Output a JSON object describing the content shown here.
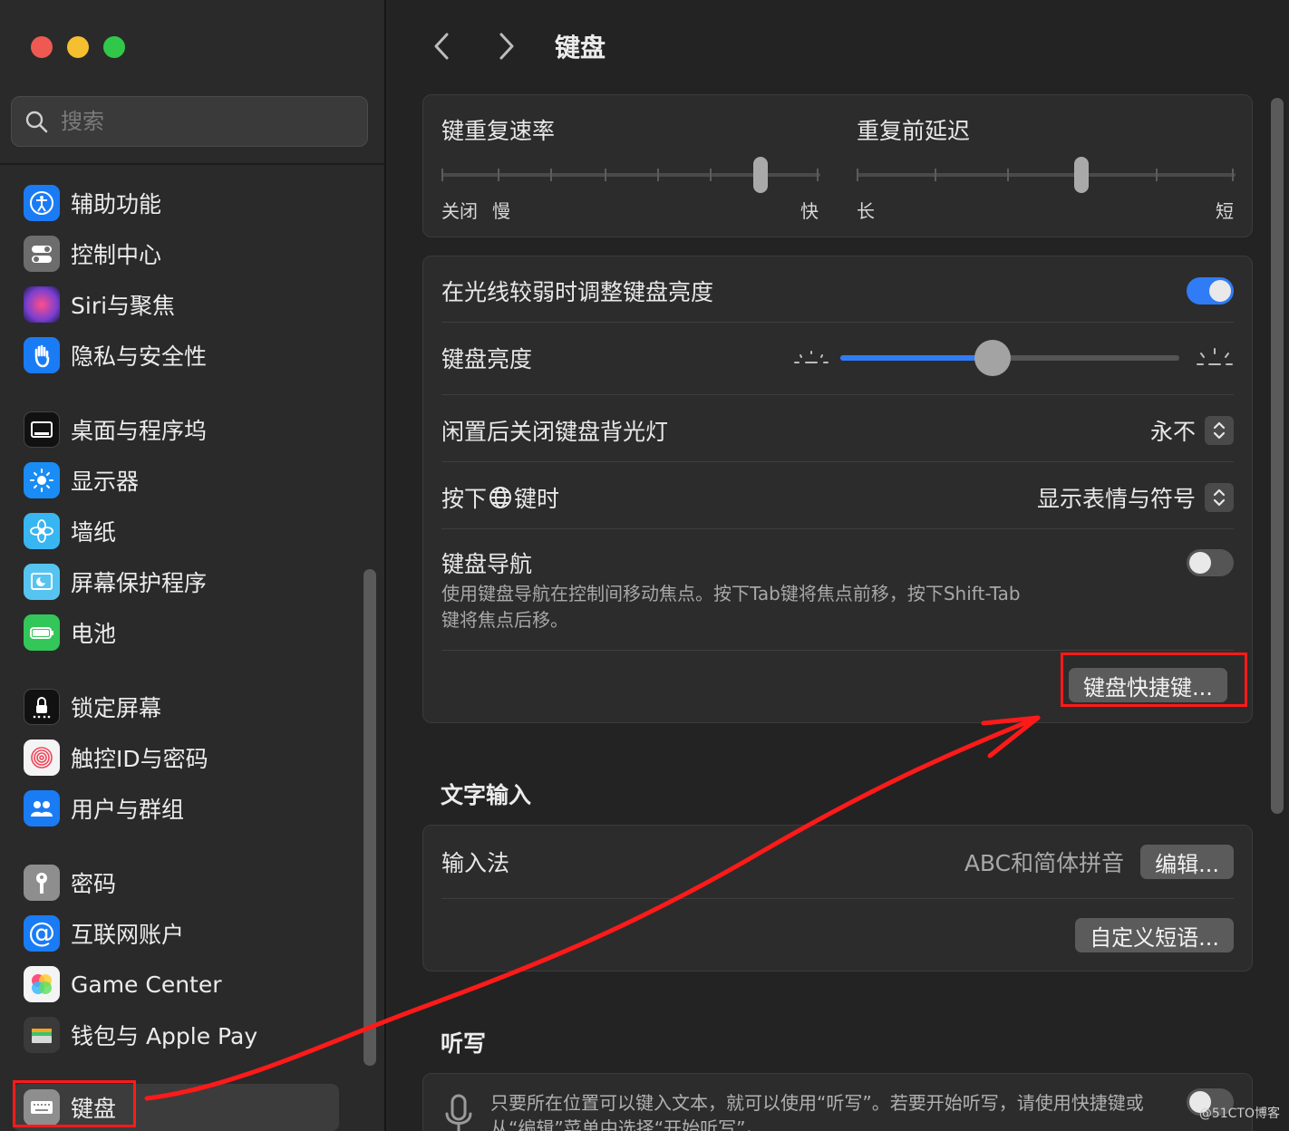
{
  "sidebar": {
    "search_placeholder": "搜索",
    "items": [
      {
        "label": "辅助功能",
        "icon": "accessibility-icon",
        "color": "#1a7cf5"
      },
      {
        "label": "控制中心",
        "icon": "control-center-icon",
        "color": "#6d6d6d"
      },
      {
        "label": "Siri与聚焦",
        "icon": "siri-icon",
        "color": "#7a3fd0"
      },
      {
        "label": "隐私与安全性",
        "icon": "hand-icon",
        "color": "#1a7cf5"
      },
      {
        "label": "桌面与程序坞",
        "icon": "dock-icon",
        "color": "#1c1c1c"
      },
      {
        "label": "显示器",
        "icon": "sun-icon",
        "color": "#1a8cf5"
      },
      {
        "label": "墙纸",
        "icon": "flower-icon",
        "color": "#38b6f2"
      },
      {
        "label": "屏幕保护程序",
        "icon": "screensaver-icon",
        "color": "#56c4f0"
      },
      {
        "label": "电池",
        "icon": "battery-icon",
        "color": "#33c759"
      },
      {
        "label": "锁定屏幕",
        "icon": "lock-icon",
        "color": "#1c1c1c"
      },
      {
        "label": "触控ID与密码",
        "icon": "fingerprint-icon",
        "color": "#f4f4f4"
      },
      {
        "label": "用户与群组",
        "icon": "users-icon",
        "color": "#1a7cf5"
      },
      {
        "label": "密码",
        "icon": "key-icon",
        "color": "#8e8e8e"
      },
      {
        "label": "互联网账户",
        "icon": "at-icon",
        "color": "#1a7cf5"
      },
      {
        "label": "Game Center",
        "icon": "game-center-icon",
        "color": "#f4f4f4"
      },
      {
        "label": "钱包与 Apple Pay",
        "icon": "wallet-icon",
        "color": "#3a3a3a"
      },
      {
        "label": "键盘",
        "icon": "keyboard-icon",
        "color": "#8e8e8e"
      }
    ]
  },
  "header": {
    "title": "键盘"
  },
  "repeat": {
    "rate_label": "键重复速率",
    "rate_off": "关闭",
    "rate_slow": "慢",
    "rate_fast": "快",
    "delay_label": "重复前延迟",
    "delay_long": "长",
    "delay_short": "短"
  },
  "settings": {
    "auto_brightness_label": "在光线较弱时调整键盘亮度",
    "brightness_label": "键盘亮度",
    "brightness_level": 0.45,
    "backlight_off_label": "闲置后关闭键盘背光灯",
    "backlight_off_value": "永不",
    "globe_label_pre": "按下",
    "globe_label_post": "键时",
    "globe_value": "显示表情与符号",
    "nav_label": "键盘导航",
    "nav_desc_1": "使用键盘导航在控制间移动焦点。按下Tab键将焦点前移，按下Shift-Tab",
    "nav_desc_2": "键将焦点后移。",
    "shortcuts_button": "键盘快捷键..."
  },
  "text_input": {
    "title": "文字输入",
    "input_label": "输入法",
    "input_value": "ABC和简体拼音",
    "edit_button": "编辑...",
    "custom_button": "自定义短语..."
  },
  "dictation": {
    "title": "听写",
    "desc_1": "只要所在位置可以键入文本，就可以使用“听写”。若要开始听写，请使用快捷键或",
    "desc_2": "从“编辑”菜单中选择“开始听写”。"
  },
  "watermark": "@51CTO博客",
  "colors": {
    "accent": "#2f7cf6",
    "annotation": "#ff1a1a"
  }
}
